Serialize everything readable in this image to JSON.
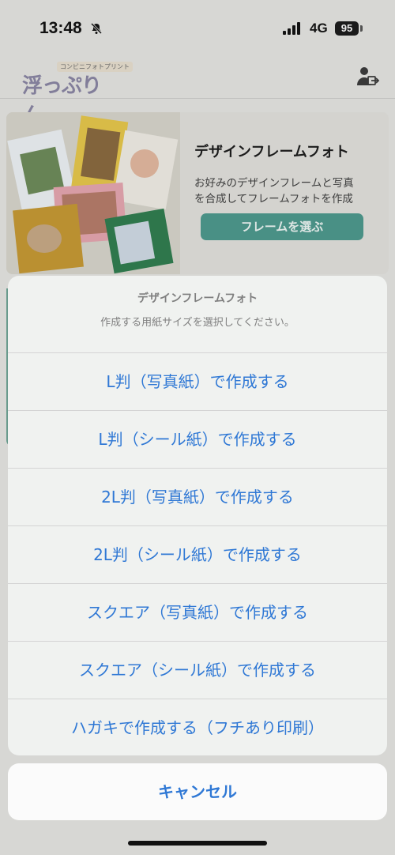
{
  "status_bar": {
    "time": "13:48",
    "network": "4G",
    "battery": "95"
  },
  "nav": {
    "logo_text": "浮っぷりん",
    "logo_subtext": "コンビニフォトプリント",
    "logout_icon": "person-logout-icon"
  },
  "banner": {
    "title": "デザインフレームフォト",
    "description_lines": [
      "お好みのデザインフレームと写真",
      "を合成してフレームフォトを作成"
    ],
    "button_label": "フレームを選ぶ"
  },
  "action_sheet": {
    "title": "デザインフレームフォト",
    "message": "作成する用紙サイズを選択してください。",
    "options": [
      "L判（写真紙）で作成する",
      "L判（シール紙）で作成する",
      "2L判（写真紙）で作成する",
      "2L判（シール紙）で作成する",
      "スクエア（写真紙）で作成する",
      "スクエア（シール紙）で作成する",
      "ハガキで作成する（フチあり印刷）"
    ],
    "cancel_label": "キャンセル"
  },
  "colors": {
    "accent": "#2f78d5",
    "button_teal": "#4d9a8e"
  }
}
